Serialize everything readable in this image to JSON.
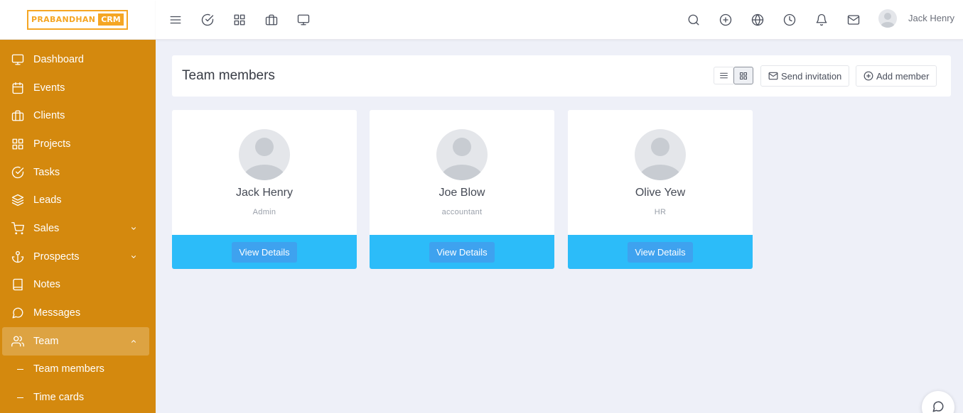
{
  "app": {
    "logo_part1": "PRABANDHAN",
    "logo_part2": "CRM",
    "accent_color": "#d4890e",
    "logo_color": "#f5a623"
  },
  "sidebar": {
    "items": [
      {
        "label": "Dashboard",
        "icon": "monitor-icon"
      },
      {
        "label": "Events",
        "icon": "calendar-icon"
      },
      {
        "label": "Clients",
        "icon": "briefcase-icon"
      },
      {
        "label": "Projects",
        "icon": "grid-icon"
      },
      {
        "label": "Tasks",
        "icon": "check-circle-icon"
      },
      {
        "label": "Leads",
        "icon": "layers-icon"
      },
      {
        "label": "Sales",
        "icon": "cart-icon"
      },
      {
        "label": "Prospects",
        "icon": "anchor-icon"
      },
      {
        "label": "Notes",
        "icon": "book-icon"
      },
      {
        "label": "Messages",
        "icon": "message-icon"
      },
      {
        "label": "Team",
        "icon": "users-icon"
      }
    ],
    "team_submenu": [
      {
        "label": "Team members"
      },
      {
        "label": "Time cards"
      }
    ]
  },
  "topbar": {
    "user_name": "Jack Henry"
  },
  "page": {
    "title": "Team members",
    "send_invitation_label": "Send invitation",
    "add_member_label": "Add member"
  },
  "members": [
    {
      "name": "Jack Henry",
      "role": "Admin",
      "button": "View Details"
    },
    {
      "name": "Joe Blow",
      "role": "accountant",
      "button": "View Details"
    },
    {
      "name": "Olive Yew",
      "role": "HR",
      "button": "View Details"
    }
  ],
  "colors": {
    "card_footer": "#2cbcf9",
    "view_details_button": "#3ea2ef"
  }
}
